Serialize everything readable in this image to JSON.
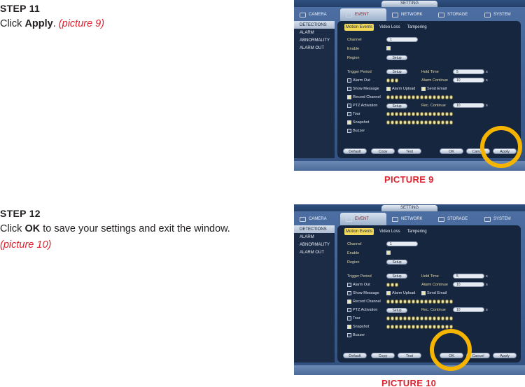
{
  "step11": {
    "title": "STEP 11",
    "text_before": "Click ",
    "bold": "Apply",
    "text_after": ". ",
    "ref": "(picture 9)"
  },
  "step12": {
    "title": "STEP 12",
    "text_before": "Click ",
    "bold": "OK",
    "text_after": " to save your settings and exit the window.",
    "ref": "(picture 10)"
  },
  "caption9": "PICTURE 9",
  "caption10": "PICTURE 10",
  "ui": {
    "window_title": "SETTING",
    "main_tabs": [
      "CAMERA",
      "EVENT",
      "NETWORK",
      "STORAGE",
      "SYSTEM"
    ],
    "sidebar": [
      "DETECTIONS",
      "ALARM",
      "ABNORMALITY",
      "ALARM OUT"
    ],
    "sub_tabs": [
      "Motion Events",
      "Video Loss",
      "Tampering"
    ],
    "channel_label": "Channel",
    "channel_value": "1",
    "enable_label": "Enable",
    "region_label": "Region",
    "setup": "Setup",
    "trigger_period": "Trigger Period",
    "hold_time": "Hold Time",
    "hold_value": "5",
    "unit_s": "s",
    "alarm_out": "Alarm Out",
    "alarm_continue": "Alarm Continue",
    "alarm_continue_value": "10",
    "show_message": "Show Message",
    "alarm_upload": "Alarm Upload",
    "send_email": "Send Email",
    "record_channel": "Record Channel",
    "ptz_activation": "PTZ Activation",
    "rec_continue": "Rec. Continue",
    "rec_continue_value": "10",
    "tour": "Tour",
    "snapshot": "Snapshot",
    "buzzer": "Buzzer",
    "buttons": {
      "default": "Default",
      "copy": "Copy",
      "test": "Test",
      "ok": "OK",
      "cancel": "Cancel",
      "apply": "Apply"
    }
  },
  "colors": {
    "caption_red": "#e0202d",
    "highlight_ring": "#f5b400"
  }
}
